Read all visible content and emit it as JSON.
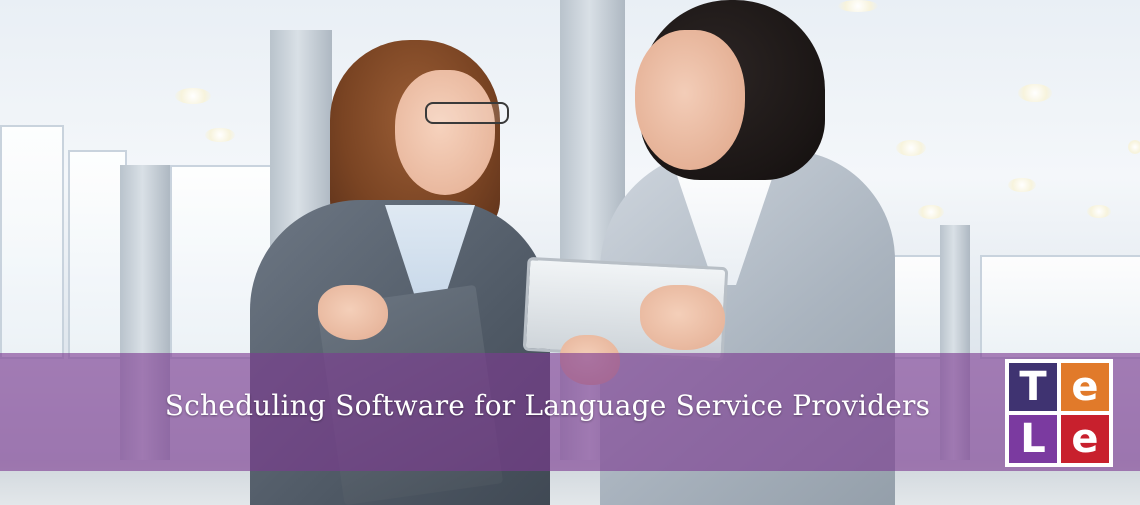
{
  "banner": {
    "headline": "Scheduling Software for Language Service Providers",
    "overlay_color": "#7c3a92"
  },
  "logo": {
    "letters": {
      "top_left": "T",
      "top_right": "e",
      "bottom_left": "L",
      "bottom_right": "e"
    },
    "colors": {
      "top_left": "#3f3371",
      "top_right": "#e17a2a",
      "bottom_left": "#7b3aa0",
      "bottom_right": "#c8202d"
    }
  },
  "hero_image": {
    "icon": "photo-two-businesswomen"
  }
}
